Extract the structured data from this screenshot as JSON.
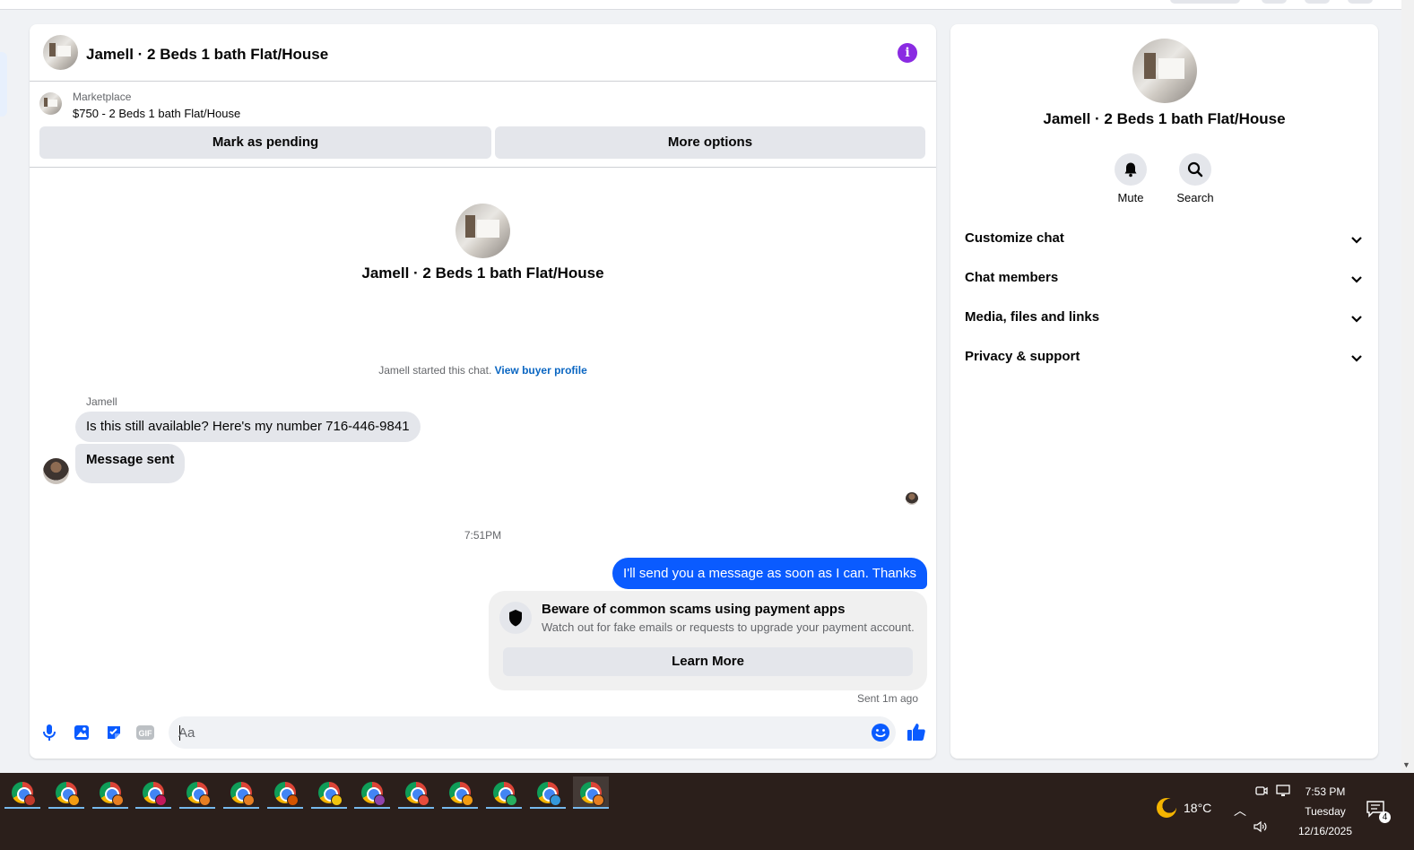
{
  "chat": {
    "title": "Jamell · 2 Beds 1 bath Flat/House",
    "listing": {
      "source": "Marketplace",
      "title": "$750 - 2 Beds 1 bath Flat/House",
      "mark_pending_label": "Mark as pending",
      "more_options_label": "More options"
    },
    "intro_name": "Jamell · 2 Beds 1 bath Flat/House",
    "system": {
      "text": "Jamell started this chat.",
      "link": "View buyer profile"
    },
    "messages": [
      {
        "sender": "Jamell",
        "text": "Is this still available? Here's my number 716-446-9841"
      },
      {
        "text": "Message sent"
      }
    ],
    "timestamp": "7:51PM",
    "outgoing": {
      "text": "I'll send you a message as soon as I can. Thanks"
    },
    "scam_card": {
      "title": "Beware of common scams using payment apps",
      "desc": "Watch out for fake emails or requests to upgrade your payment account.",
      "button": "Learn More"
    },
    "sent_status": "Sent 1m ago",
    "composer": {
      "placeholder": "Aa"
    }
  },
  "details": {
    "name": "Jamell · 2 Beds 1 bath Flat/House",
    "actions": [
      {
        "label": "Mute",
        "icon": "bell-icon"
      },
      {
        "label": "Search",
        "icon": "search-icon"
      }
    ],
    "sections": [
      {
        "label": "Customize chat"
      },
      {
        "label": "Chat members"
      },
      {
        "label": "Media, files and links"
      },
      {
        "label": "Privacy & support"
      }
    ]
  },
  "taskbar": {
    "weather": "18°C",
    "time": "7:53 PM",
    "day": "Tuesday",
    "date": "12/16/2025",
    "notifications": "4",
    "app_badges": [
      "#c0392b",
      "#f39c12",
      "#e67e22",
      "#c2185b",
      "#e67e22",
      "#e67e22",
      "#d35400",
      "#f1c40f",
      "#8e44ad",
      "#e74c3c",
      "#f39c12",
      "#27ae60",
      "#3498db",
      "#e67e22"
    ]
  },
  "colors": {
    "accent": "#0a5bff",
    "info": "#8a2be2",
    "link": "#0a66c2",
    "taskbar": "#2b1f1b"
  }
}
